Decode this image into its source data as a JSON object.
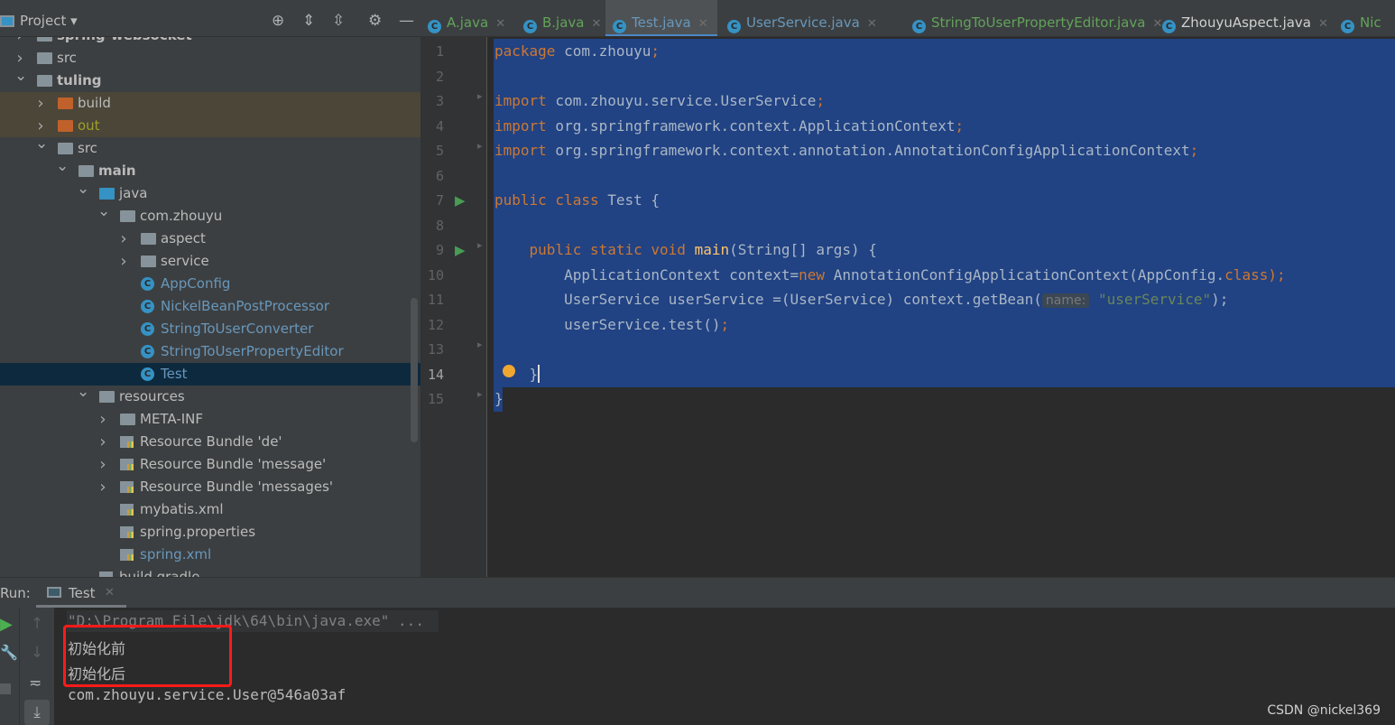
{
  "project": {
    "title": "Project",
    "tree": [
      {
        "label": "spring-websocket",
        "level": 0,
        "arrow": ">",
        "icon": "module",
        "bold": true
      },
      {
        "label": "src",
        "level": 0,
        "arrow": ">",
        "icon": "folder"
      },
      {
        "label": "tuling",
        "level": 0,
        "arrow": "v",
        "icon": "module",
        "bold": true
      },
      {
        "label": "build",
        "level": 1,
        "arrow": ">",
        "icon": "folder-excluded",
        "excluded": true
      },
      {
        "label": "out",
        "level": 1,
        "arrow": ">",
        "icon": "folder-excluded",
        "excluded": true,
        "color": "#9e9e2a"
      },
      {
        "label": "src",
        "level": 1,
        "arrow": "v",
        "icon": "folder"
      },
      {
        "label": "main",
        "level": 2,
        "arrow": "v",
        "icon": "folder",
        "bold": true
      },
      {
        "label": "java",
        "level": 3,
        "arrow": "v",
        "icon": "source-folder"
      },
      {
        "label": "com.zhouyu",
        "level": 4,
        "arrow": "v",
        "icon": "package"
      },
      {
        "label": "aspect",
        "level": 5,
        "arrow": ">",
        "icon": "package"
      },
      {
        "label": "service",
        "level": 5,
        "arrow": ">",
        "icon": "package"
      },
      {
        "label": "AppConfig",
        "level": 5,
        "icon": "class",
        "color": "#6897bb"
      },
      {
        "label": "NickelBeanPostProcessor",
        "level": 5,
        "icon": "class",
        "color": "#6897bb"
      },
      {
        "label": "StringToUserConverter",
        "level": 5,
        "icon": "class",
        "color": "#6897bb"
      },
      {
        "label": "StringToUserPropertyEditor",
        "level": 5,
        "icon": "class",
        "color": "#6897bb"
      },
      {
        "label": "Test",
        "level": 5,
        "icon": "class-runnable",
        "color": "#6897bb",
        "selected": true
      },
      {
        "label": "resources",
        "level": 3,
        "arrow": "v",
        "icon": "resources-folder"
      },
      {
        "label": "META-INF",
        "level": 4,
        "arrow": ">",
        "icon": "folder"
      },
      {
        "label": "Resource Bundle 'de'",
        "level": 4,
        "arrow": ">",
        "icon": "resource-bundle"
      },
      {
        "label": "Resource Bundle 'message'",
        "level": 4,
        "arrow": ">",
        "icon": "resource-bundle"
      },
      {
        "label": "Resource Bundle 'messages'",
        "level": 4,
        "arrow": ">",
        "icon": "resource-bundle"
      },
      {
        "label": "mybatis.xml",
        "level": 4,
        "icon": "xml-file"
      },
      {
        "label": "spring.properties",
        "level": 4,
        "icon": "properties-file"
      },
      {
        "label": "spring.xml",
        "level": 4,
        "icon": "spring-xml-file",
        "color": "#6897bb"
      },
      {
        "label": "build.gradle",
        "level": 3,
        "icon": "gradle-file"
      }
    ]
  },
  "tabs": [
    {
      "label": "A.java",
      "color": "#62a35a"
    },
    {
      "label": "B.java",
      "color": "#62a35a"
    },
    {
      "label": "Test.java",
      "color": "#6897bb",
      "active": true
    },
    {
      "label": "UserService.java",
      "color": "#6897bb"
    },
    {
      "label": "StringToUserPropertyEditor.java",
      "color": "#62a35a"
    },
    {
      "label": "ZhouyuAspect.java",
      "color": "#d0d0d0"
    },
    {
      "label": "Nic",
      "color": "#62a35a"
    }
  ],
  "code": [
    [
      [
        "package",
        "kw"
      ],
      [
        " com.zhouyu",
        ""
      ],
      [
        ";",
        "kw"
      ]
    ],
    [],
    [
      [
        "import",
        "kw"
      ],
      [
        " com.zhouyu.service.UserService",
        ""
      ],
      [
        ";",
        "kw"
      ]
    ],
    [
      [
        "import",
        "kw"
      ],
      [
        " org.springframework.context.ApplicationContext",
        ""
      ],
      [
        ";",
        "kw"
      ]
    ],
    [
      [
        "import",
        "kw"
      ],
      [
        " org.springframework.context.annotation.AnnotationConfigApplicationContext",
        ""
      ],
      [
        ";",
        "kw"
      ]
    ],
    [],
    [
      [
        "public class",
        "kw"
      ],
      [
        " Test {",
        ""
      ]
    ],
    [],
    [
      [
        "    public static void ",
        "kw"
      ],
      [
        "main",
        "fn"
      ],
      [
        "(String[] args) {",
        ""
      ]
    ],
    [
      [
        "        ApplicationContext context=",
        ""
      ],
      [
        "new",
        "kw"
      ],
      [
        " AnnotationConfigApplicationContext(AppConfig.",
        ""
      ],
      [
        "class",
        "kw"
      ],
      [
        ");",
        "kw"
      ]
    ],
    [
      [
        "        UserService userService =(UserService) context.getBean(",
        ""
      ],
      [
        "name:",
        "hint"
      ],
      [
        " ",
        ""
      ],
      [
        "\"userService\"",
        "str"
      ],
      [
        ");",
        ""
      ]
    ],
    [
      [
        "        userService.test()",
        ""
      ],
      [
        ";",
        "kw"
      ]
    ],
    [],
    [
      [
        "    }",
        ""
      ]
    ],
    [
      [
        "}",
        ""
      ]
    ]
  ],
  "run": {
    "label": "Run:",
    "tab": "Test",
    "output": [
      "\"D:\\Program File\\jdk\\64\\bin\\java.exe\" ...",
      "初始化前",
      "初始化后",
      "com.zhouyu.service.User@546a03af"
    ]
  },
  "watermark": "CSDN @nickel369",
  "colors": {
    "selection": "#214283",
    "accent": "#4a88c7",
    "highlight_box": "#ff1a1a"
  }
}
